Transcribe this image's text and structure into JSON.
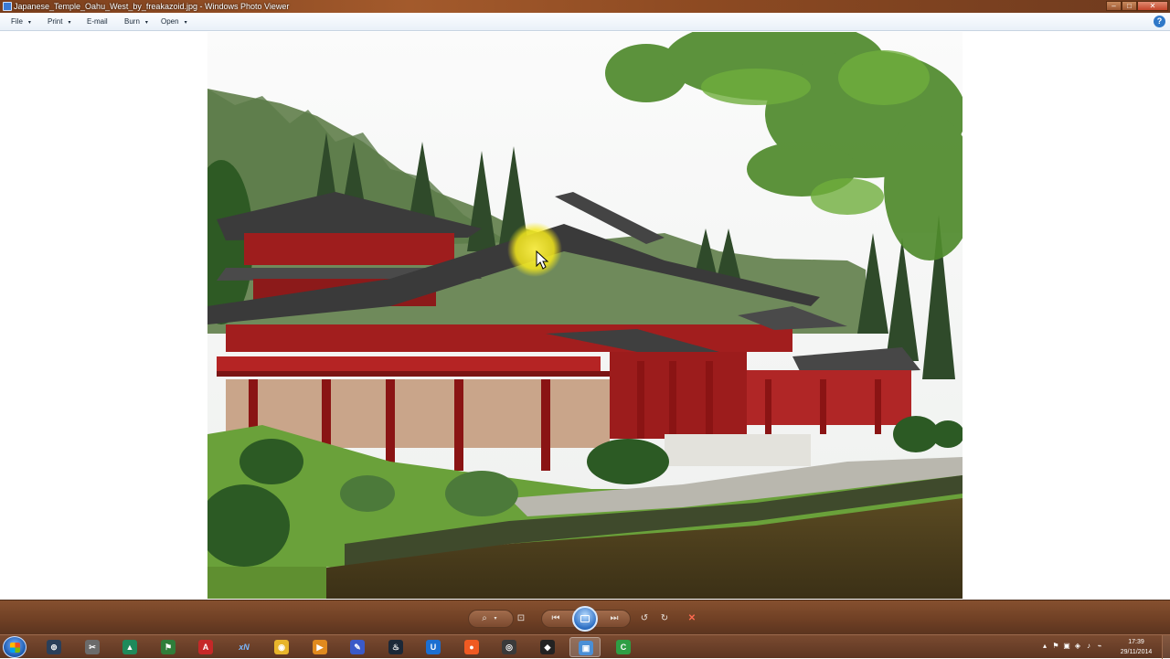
{
  "window": {
    "title": "Japanese_Temple_Oahu_West_by_freakazoid.jpg - Windows Photo Viewer"
  },
  "menu": {
    "items": [
      {
        "label": "File",
        "has_arrow": true
      },
      {
        "label": "Print",
        "has_arrow": true
      },
      {
        "label": "E-mail",
        "has_arrow": false
      },
      {
        "label": "Burn",
        "has_arrow": true
      },
      {
        "label": "Open",
        "has_arrow": true
      }
    ],
    "help_symbol": "?"
  },
  "photo": {
    "subject": "Japanese temple with red pillars, mountains and pond"
  },
  "controls": {
    "zoom_icon": "magnifier-icon",
    "fit_icon": "actual-size-icon",
    "prev_icon": "previous-icon",
    "slideshow_icon": "slideshow-icon",
    "next_icon": "next-icon",
    "rotate_ccw_icon": "rotate-counterclockwise-icon",
    "rotate_cw_icon": "rotate-clockwise-icon",
    "delete_symbol": "✕"
  },
  "taskbar": {
    "apps": [
      {
        "name": "steam-logo-icon",
        "color": "#2a3f5a",
        "glyph": "⊚"
      },
      {
        "name": "tools-icon",
        "color": "#6b6b6b",
        "glyph": "✂"
      },
      {
        "name": "gpu-utility-icon",
        "color": "#1f8a5b",
        "glyph": "▲"
      },
      {
        "name": "game-launcher-icon",
        "color": "#2f7d3a",
        "glyph": "⚑"
      },
      {
        "name": "pdf-reader-icon",
        "color": "#c62828",
        "glyph": "A"
      },
      {
        "name": "xn-icon",
        "color": "transparent",
        "glyph": "xN"
      },
      {
        "name": "chrome-icon",
        "color": "#e8b52b",
        "glyph": "◉"
      },
      {
        "name": "media-player-icon",
        "color": "#e08a1e",
        "glyph": "▶"
      },
      {
        "name": "notepad-icon",
        "color": "#3a5ac8",
        "glyph": "✎"
      },
      {
        "name": "steam-icon",
        "color": "#1b2838",
        "glyph": "♨"
      },
      {
        "name": "uplay-icon",
        "color": "#1c6fd1",
        "glyph": "U"
      },
      {
        "name": "origin-icon",
        "color": "#f05a22",
        "glyph": "●"
      },
      {
        "name": "recorder-icon",
        "color": "#3a3a3a",
        "glyph": "◎"
      },
      {
        "name": "unity-icon",
        "color": "#222222",
        "glyph": "◆"
      },
      {
        "name": "photo-viewer-icon",
        "color": "#4a8fd6",
        "glyph": "▣"
      },
      {
        "name": "camtasia-icon",
        "color": "#2e9e44",
        "glyph": "C"
      }
    ],
    "tray_symbols": [
      "▴",
      "⚑",
      "▣",
      "◈",
      "♪",
      "⌁"
    ],
    "time": "17:39",
    "date": "29/11/2014"
  }
}
